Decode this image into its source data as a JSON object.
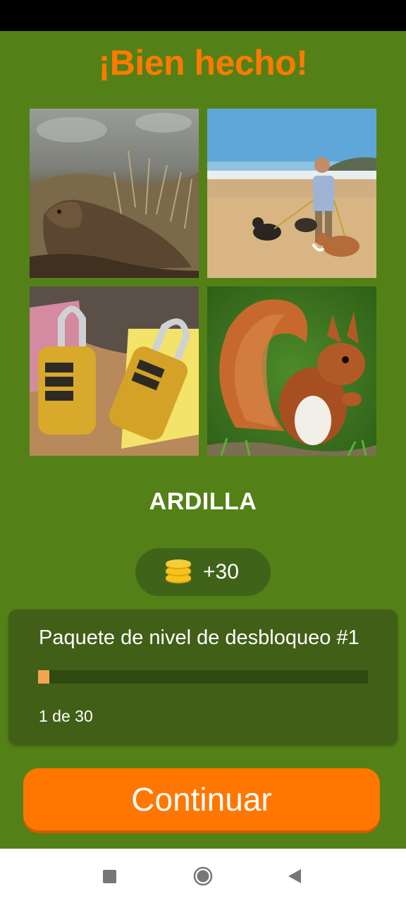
{
  "header": {
    "title": "¡Bien hecho!"
  },
  "puzzle": {
    "images": [
      {
        "subject": "marmota entre hierba seca"
      },
      {
        "subject": "hombre paseando perros en la playa"
      },
      {
        "subject": "candados dorados de combinación"
      },
      {
        "subject": "ardilla roja"
      }
    ],
    "answer": "ARDILLA"
  },
  "reward": {
    "icon": "coins-icon",
    "text": "+30"
  },
  "progress": {
    "title": "Paquete de nivel de desbloqueo #1",
    "current": 1,
    "total": 30,
    "count_text": "1 de 30"
  },
  "actions": {
    "continue_label": "Continuar"
  },
  "colors": {
    "background": "#538117",
    "title": "#ff7a00",
    "button": "#ff7700",
    "progress_fill": "#f5a552"
  },
  "navigation": {
    "icons": [
      "recents-icon",
      "home-icon",
      "back-icon"
    ]
  }
}
